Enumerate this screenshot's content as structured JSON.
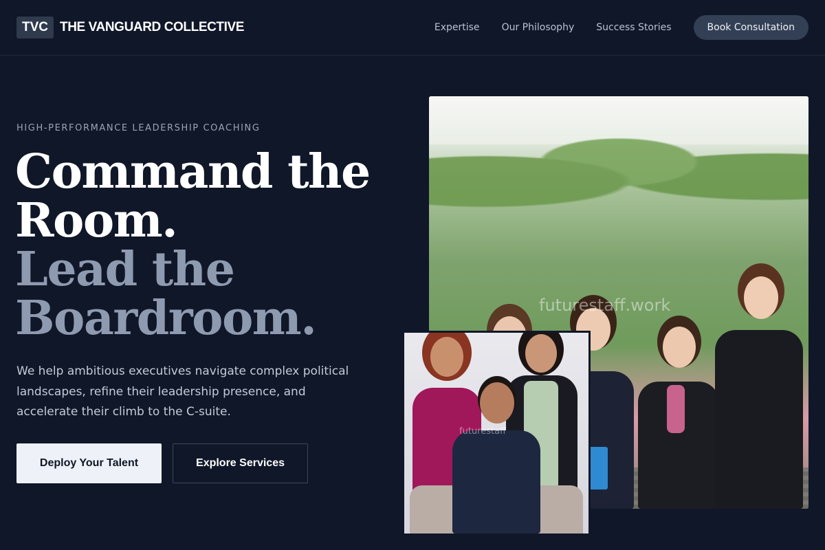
{
  "brand": {
    "badge": "TVC",
    "name": "THE VANGUARD COLLECTIVE"
  },
  "nav": {
    "links": [
      "Expertise",
      "Our Philosophy",
      "Success Stories"
    ],
    "cta": "Book Consultation"
  },
  "hero": {
    "eyebrow": "HIGH-PERFORMANCE LEADERSHIP COACHING",
    "headline_line1": "Command the",
    "headline_line2": "Room.",
    "headline_line3": "Lead the",
    "headline_line4": "Boardroom.",
    "lede": "We help ambitious executives navigate complex political landscapes, refine their leadership presence, and accelerate their climb to the C-suite.",
    "primary_button": "Deploy Your Talent",
    "secondary_button": "Explore Services"
  },
  "images": {
    "main_watermark": "futurestaff.work",
    "inset_watermark": "futurestaff"
  },
  "colors": {
    "background": "#101729",
    "headline_white": "#ffffff",
    "headline_muted": "#8e9ab0",
    "cta_bg": "#333f54",
    "primary_button_bg": "#eef2f8"
  }
}
